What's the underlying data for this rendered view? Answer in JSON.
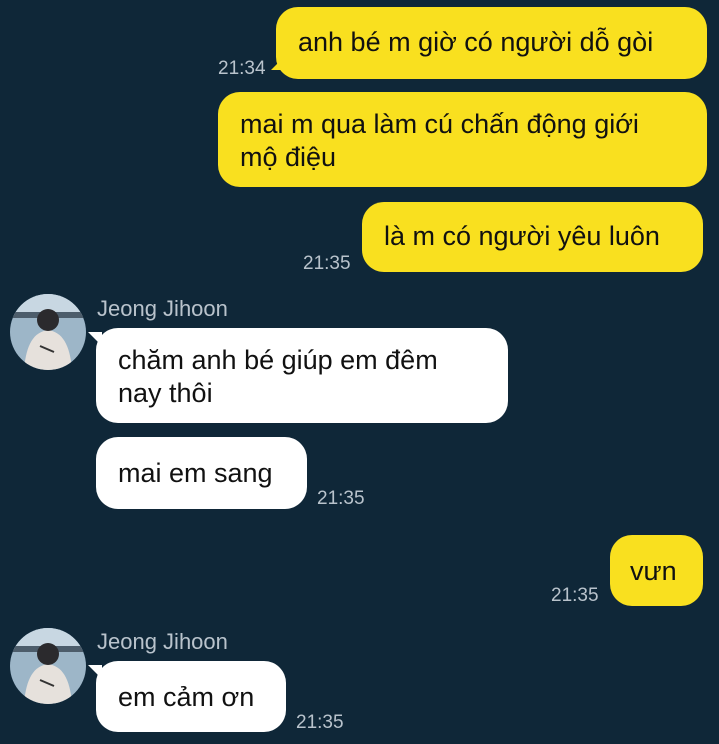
{
  "colors": {
    "background": "#0f2738",
    "outgoing_bubble": "#f9e01f",
    "incoming_bubble": "#ffffff",
    "timestamp": "#b9c3cc"
  },
  "messages": [
    {
      "id": "m1",
      "sender": "me",
      "text": "anh bé m giờ có người dỗ gòi",
      "time": "21:34"
    },
    {
      "id": "m2",
      "sender": "me",
      "text_lines": [
        "mai m qua làm cú chấn động giới",
        "mộ điệu"
      ]
    },
    {
      "id": "m3",
      "sender": "me",
      "text": "là m có người yêu luôn",
      "time": "21:35"
    },
    {
      "id": "m4",
      "sender": "them",
      "name": "Jeong Jihoon",
      "avatar_icon": "profile-photo",
      "text_lines": [
        "chăm anh bé giúp em đêm",
        "nay thôi"
      ]
    },
    {
      "id": "m5",
      "sender": "them",
      "text": "mai em sang",
      "time": "21:35"
    },
    {
      "id": "m6",
      "sender": "me",
      "text": "vưn",
      "time": "21:35"
    },
    {
      "id": "m7",
      "sender": "them",
      "name": "Jeong Jihoon",
      "avatar_icon": "profile-photo",
      "text": "em cảm ơn",
      "time": "21:35"
    }
  ]
}
